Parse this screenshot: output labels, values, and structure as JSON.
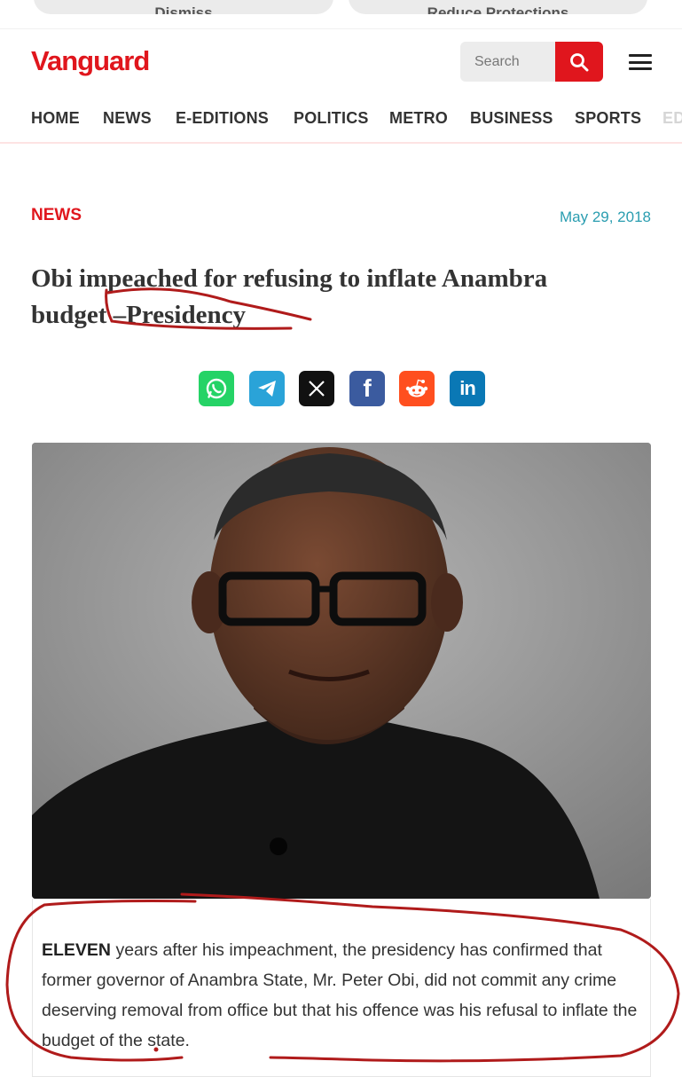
{
  "top_buttons": [
    "Dismiss",
    "Reduce Protections"
  ],
  "brand": {
    "logo_text": "Vanguard",
    "accent": "#e0161d"
  },
  "search": {
    "placeholder": "Search"
  },
  "nav": [
    "HOME",
    "NEWS",
    "E-EDITIONS",
    "POLITICS",
    "METRO",
    "BUSINESS",
    "SPORTS",
    "ED"
  ],
  "article": {
    "category": "NEWS",
    "date": "May 29, 2018",
    "headline": "Obi impeached for refusing to inflate Anambra budget –Presidency",
    "intro_lead": "ELEVEN",
    "intro_rest": " years after his impeachment, the presidency has confirmed that former governor of Anambra State, Mr. Peter Obi, did not commit any crime deserving removal from office but that his offence was his refusal to inflate the budget of the state."
  },
  "share_icons": [
    "whatsapp-icon",
    "telegram-icon",
    "x-icon",
    "facebook-icon",
    "reddit-icon",
    "linkedin-icon"
  ],
  "colors": {
    "whatsapp": "#25d366",
    "telegram": "#2aa3d8",
    "x": "#111111",
    "facebook": "#3b5b9f",
    "reddit": "#ff4f1f",
    "linkedin": "#0a78b5",
    "date": "#2a9db0",
    "annotation": "#b01b1b"
  }
}
